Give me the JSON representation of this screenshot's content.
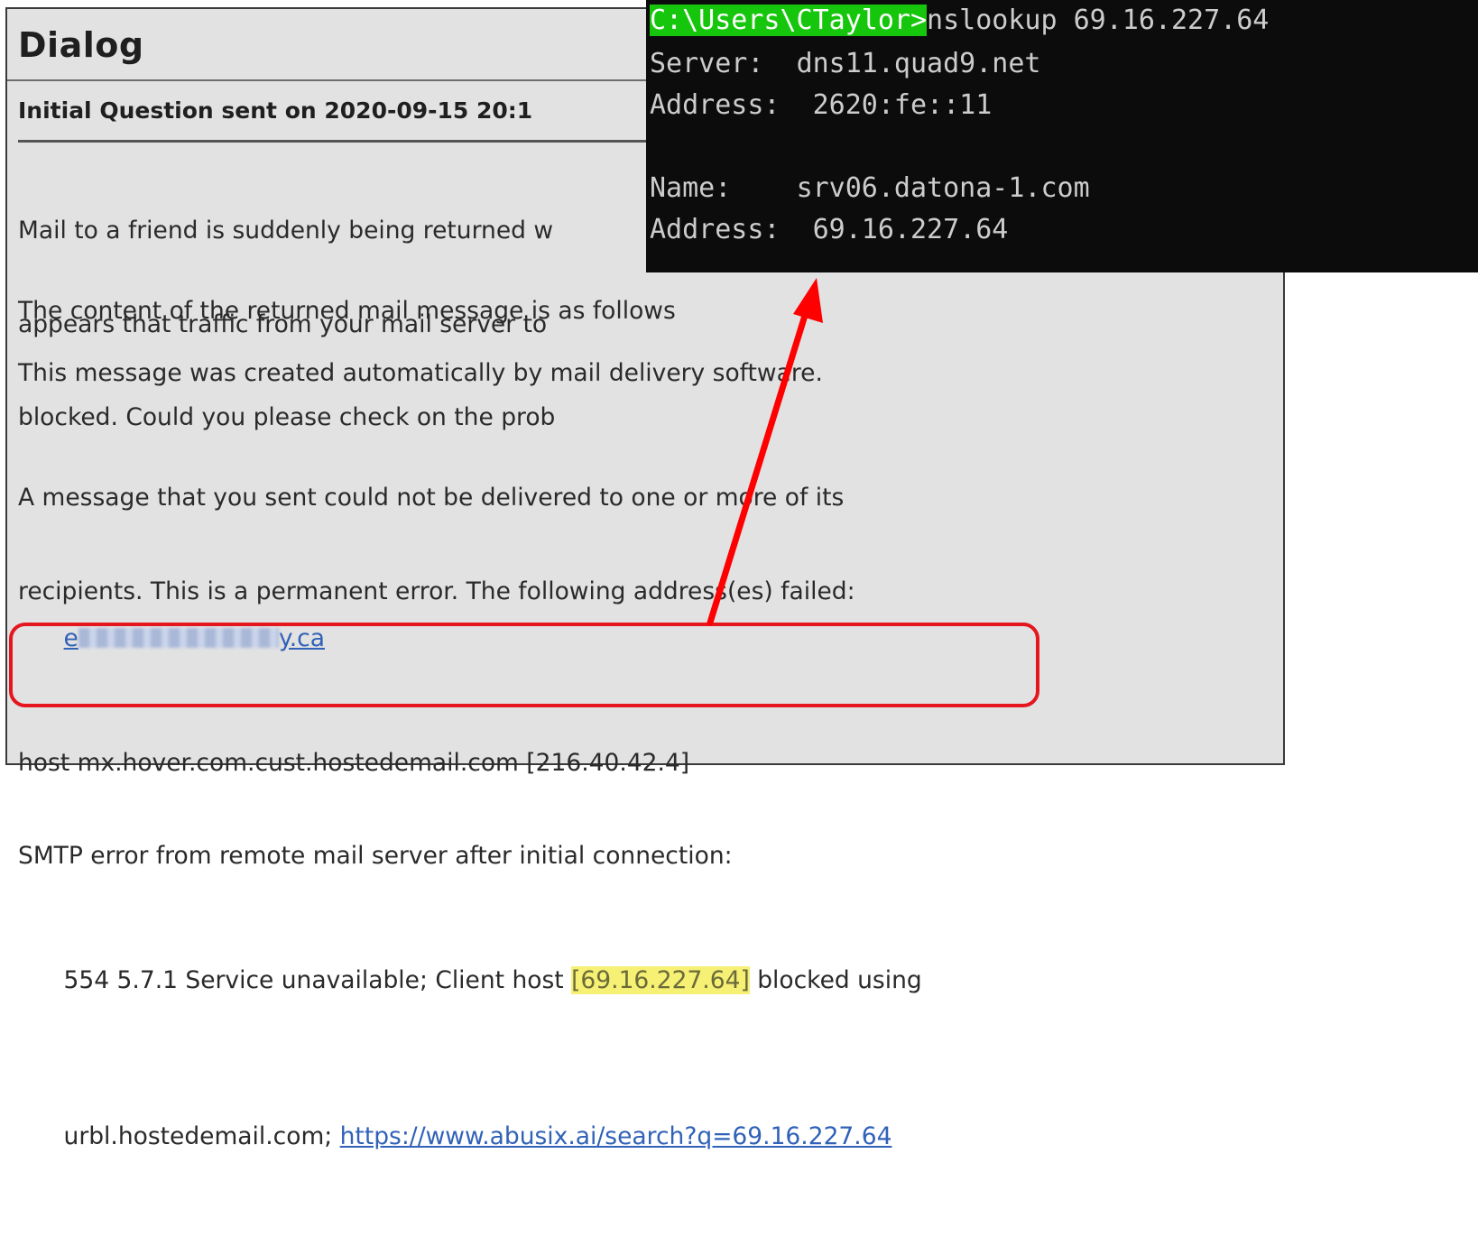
{
  "dialog": {
    "title": "Dialog",
    "question_heading": "Initial Question sent on 2020-09-15 20:1",
    "paragraph1": [
      "Mail to a friend is suddenly being returned w",
      "appears that traffic from your mail server to",
      "blocked. Could you please check on the prob"
    ],
    "paragraph2": "The content of the returned mail message is as follows",
    "paragraph3": "This message was created automatically by mail delivery software.",
    "paragraph4": [
      "A message that you sent could not be delivered to one or more of its",
      "recipients. This is a permanent error. The following address(es) failed:"
    ],
    "email_prefix": "e",
    "email_suffix": "y.ca",
    "host_line": "host mx.hover.com.cust.hostedemail.com [216.40.42.4]",
    "smtp_line": "SMTP error from remote mail server after initial connection:",
    "error_prefix": "554 5.7.1 Service unavailable; Client host ",
    "error_ip": "[69.16.227.64]",
    "error_suffix": " blocked using",
    "rbl_prefix": "urbl.hostedemail.com; ",
    "rbl_link": "https://www.abusix.ai/search?q=69.16.227.64"
  },
  "terminal": {
    "prompt": "C:\\Users\\CTaylor>",
    "command": "nslookup 69.16.227.64",
    "server_label": "Server:  ",
    "server_value": "dns11.quad9.net",
    "address1_label": "Address:  ",
    "address1_value": "2620:fe::11",
    "name_label": "Name:    ",
    "name_value": "srv06.datona-1.com",
    "address2_label": "Address:  ",
    "address2_value": "69.16.227.64"
  },
  "colors": {
    "highlight_box": "#e5161e",
    "arrow": "#ff0000",
    "prompt_bg": "#16c60c",
    "terminal_bg": "#0c0c0c",
    "ip_highlight": "#f6f074",
    "link": "#3162b8"
  }
}
